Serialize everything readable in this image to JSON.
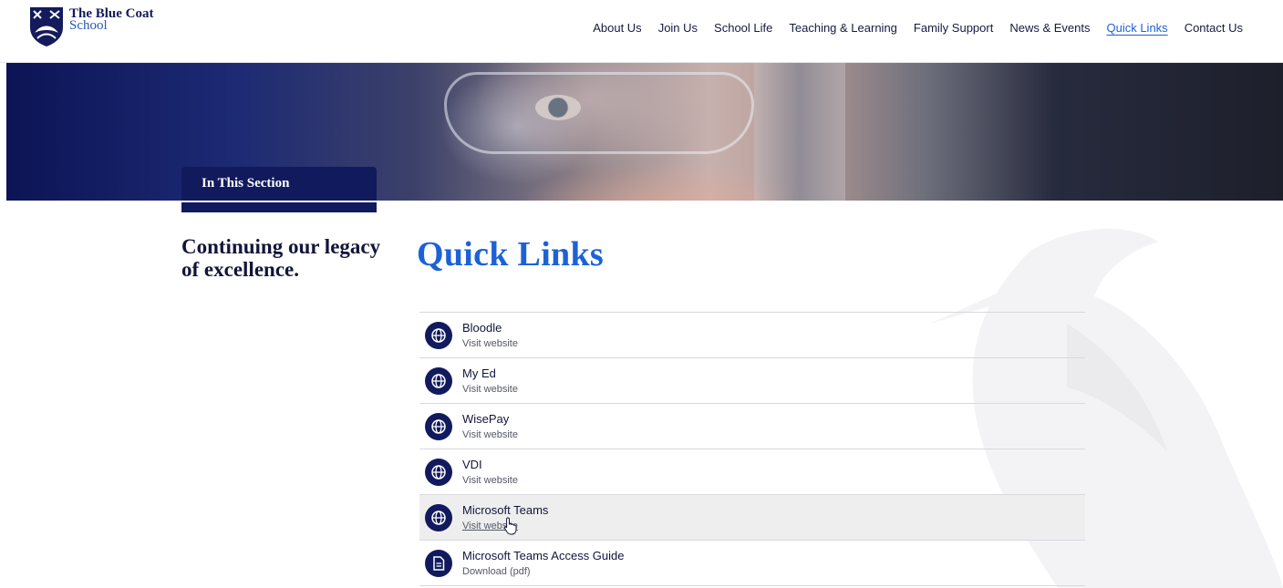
{
  "header": {
    "logo_line1": "The Blue Coat",
    "logo_line2": "School",
    "nav": [
      {
        "label": "About Us"
      },
      {
        "label": "Join Us"
      },
      {
        "label": "School Life"
      },
      {
        "label": "Teaching & Learning"
      },
      {
        "label": "Family Support"
      },
      {
        "label": "News & Events"
      },
      {
        "label": "Quick Links",
        "active": true
      },
      {
        "label": "Contact Us"
      }
    ]
  },
  "section_tab": "In This Section",
  "tagline": "Continuing our legacy of excellence.",
  "page_title": "Quick Links",
  "links": [
    {
      "title": "Bloodle",
      "sub": "Visit website",
      "icon": "globe-icon"
    },
    {
      "title": "My Ed",
      "sub": "Visit website",
      "icon": "globe-icon"
    },
    {
      "title": "WisePay",
      "sub": "Visit website",
      "icon": "globe-icon"
    },
    {
      "title": "VDI",
      "sub": "Visit website",
      "icon": "globe-icon"
    },
    {
      "title": "Microsoft Teams",
      "sub": "Visit website",
      "icon": "globe-icon",
      "hovered": true
    },
    {
      "title": "Microsoft Teams Access Guide",
      "sub": "Download (pdf)",
      "icon": "document-icon"
    }
  ],
  "colors": {
    "navy": "#121a5e",
    "accent_blue": "#1c62d6",
    "hover_row": "#eeeeef"
  }
}
